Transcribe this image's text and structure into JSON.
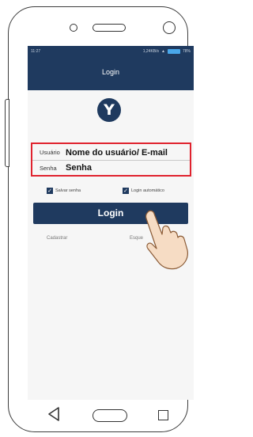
{
  "status_bar": {
    "time": "11:27",
    "net_speed": "1,24KB/s",
    "battery_percent": "78%"
  },
  "app_bar": {
    "title": "Login"
  },
  "logo": {
    "letter": "Y"
  },
  "form": {
    "username_label": "Usuário",
    "username_value": "Nome do usuário/ E-mail",
    "password_label": "Senha",
    "password_value": "Senha"
  },
  "options": {
    "save_password": "Salvar senha",
    "auto_login": "Login automático"
  },
  "login_button": "Login",
  "links": {
    "register": "Cadastrar",
    "forgot": "Esque"
  },
  "colors": {
    "primary": "#1f3a5f",
    "highlight": "#e0222e",
    "battery": "#49a7ea"
  },
  "icons": [
    "back-triangle-icon",
    "home-pill-icon",
    "recent-square-icon",
    "pointing-hand-icon"
  ]
}
